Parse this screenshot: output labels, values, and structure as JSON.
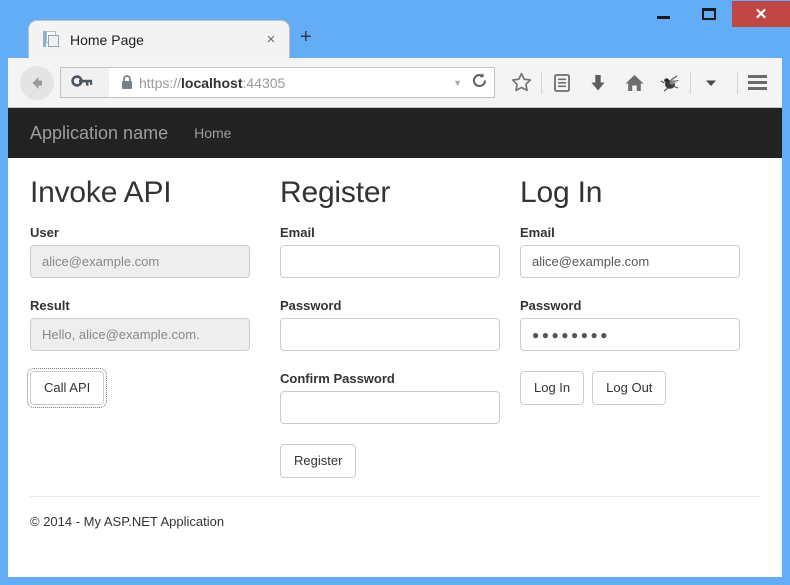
{
  "window": {
    "controls": {
      "minimize_label": "–",
      "maximize_label": "❐",
      "close_label": "✕"
    },
    "accent_blue": "#63adf7",
    "close_red": "#c14747"
  },
  "browser": {
    "tab": {
      "title": "Home Page",
      "close_label": "×",
      "favicon_name": "page-document-favicon"
    },
    "newtab_label": "+",
    "urlbar": {
      "scheme": "https://",
      "host": "localhost",
      "port": ":44305",
      "full_url": "https://localhost:44305",
      "dropdown_label": "▼"
    },
    "toolbar_icons": [
      "reload-icon",
      "bookmark-star-icon",
      "reader-list-icon",
      "download-icon",
      "home-icon",
      "firebug-bug-icon",
      "chevron-down-icon",
      "hamburger-menu-icon"
    ]
  },
  "site": {
    "navbar": {
      "brand": "Application name",
      "links": [
        {
          "label": "Home"
        }
      ]
    },
    "columns": {
      "invoke_api": {
        "heading": "Invoke API",
        "user_label": "User",
        "user_value": "alice@example.com",
        "result_label": "Result",
        "result_value": "Hello, alice@example.com.",
        "call_button": "Call API"
      },
      "register": {
        "heading": "Register",
        "email_label": "Email",
        "email_value": "",
        "password_label": "Password",
        "password_value": "",
        "confirm_label": "Confirm Password",
        "confirm_value": "",
        "register_button": "Register"
      },
      "login": {
        "heading": "Log In",
        "email_label": "Email",
        "email_value": "alice@example.com",
        "password_label": "Password",
        "password_value": "●●●●●●●●",
        "login_button": "Log In",
        "logout_button": "Log Out"
      }
    },
    "footer": {
      "text": "© 2014 - My ASP.NET Application"
    }
  }
}
